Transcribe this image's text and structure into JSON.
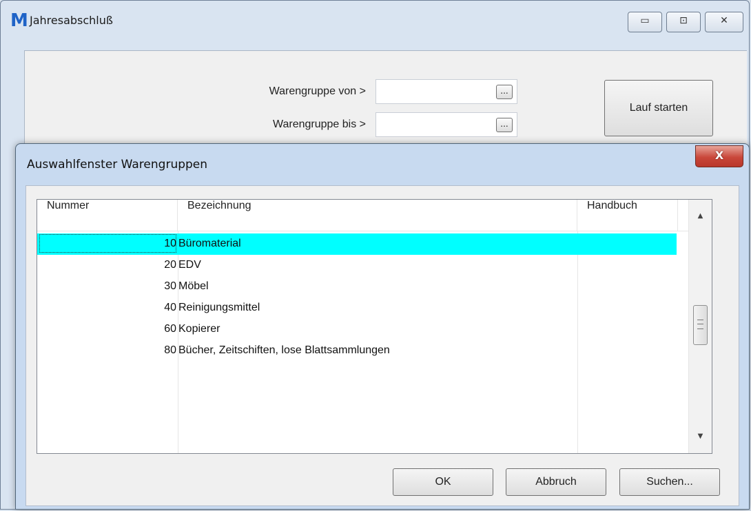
{
  "main_window": {
    "logo": "M",
    "title": "Jahresabschluß",
    "caption_buttons": {
      "minimize": "▭",
      "maximize": "⊡",
      "close": "✕"
    },
    "form": {
      "label_from": "Warengruppe von >",
      "label_to": "Warengruppe bis >",
      "value_from": "",
      "value_to": "",
      "browse_label": "...",
      "run_button": "Lauf starten"
    }
  },
  "dialog": {
    "title": "Auswahlfenster Warengruppen",
    "close_glyph": "X",
    "columns": [
      "Nummer",
      "Bezeichnung",
      "Handbuch"
    ],
    "rows": [
      {
        "num": "10",
        "bez": "Büromaterial",
        "handbuch": "",
        "selected": true
      },
      {
        "num": "20",
        "bez": "EDV",
        "handbuch": ""
      },
      {
        "num": "30",
        "bez": "Möbel",
        "handbuch": ""
      },
      {
        "num": "40",
        "bez": "Reinigungsmittel",
        "handbuch": ""
      },
      {
        "num": "60",
        "bez": "Kopierer",
        "handbuch": ""
      },
      {
        "num": "80",
        "bez": "Bücher, Zeitschiften, lose Blattsammlungen",
        "handbuch": ""
      }
    ],
    "scroll": {
      "up": "▲",
      "down": "▼"
    },
    "buttons": {
      "ok": "OK",
      "cancel": "Abbruch",
      "search": "Suchen..."
    },
    "selection_color": "#00ffff"
  }
}
